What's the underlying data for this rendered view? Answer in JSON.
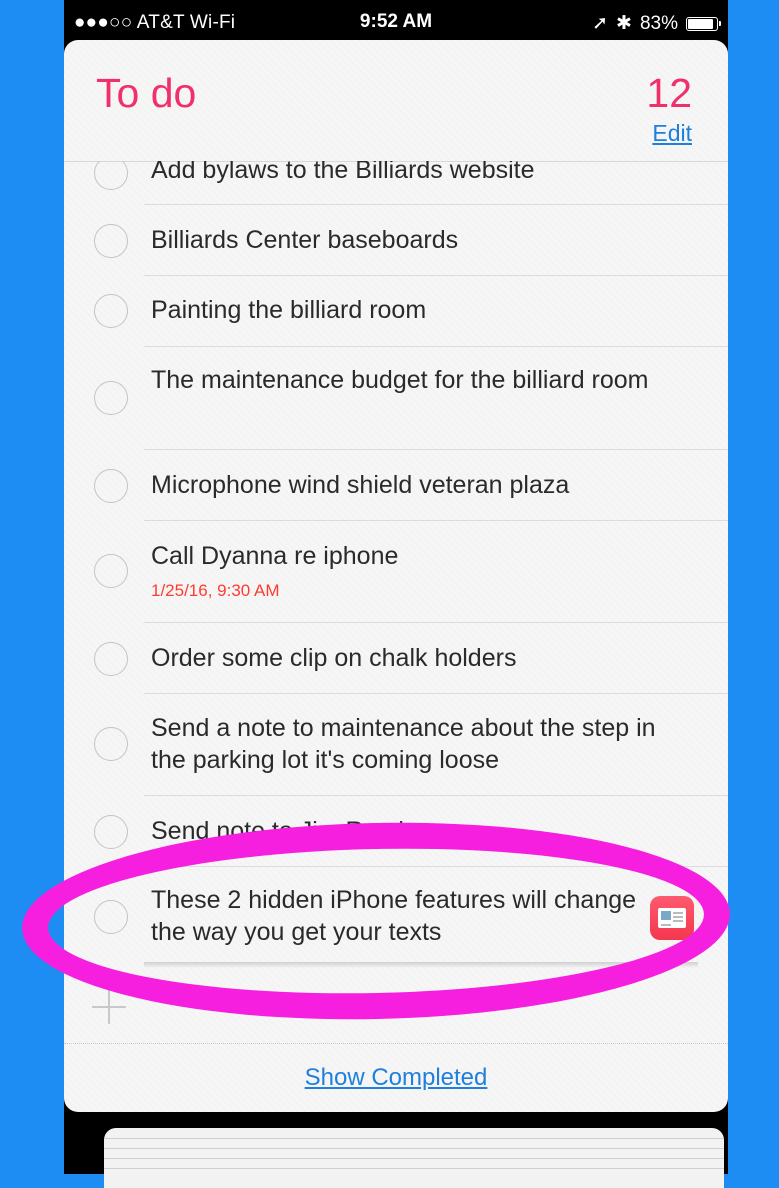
{
  "status_bar": {
    "carrier": "●●●○○ AT&T Wi-Fi",
    "time": "9:52 AM",
    "battery": "83%"
  },
  "list": {
    "title": "To do",
    "count": "12",
    "edit_label": "Edit",
    "items": [
      {
        "text": "Add bylaws to the Billiards website"
      },
      {
        "text": "Billiards Center baseboards"
      },
      {
        "text": "Painting the billiard room"
      },
      {
        "text": "The maintenance budget for the billiard room"
      },
      {
        "text": "Microphone wind shield veteran plaza"
      },
      {
        "text": "Call Dyanna re iphone",
        "due": "1/25/16, 9:30 AM"
      },
      {
        "text": "Order some clip on chalk holders"
      },
      {
        "text": "Send a note to maintenance about the step in the parking lot it's coming loose"
      },
      {
        "text": "Send note to Jim Romine"
      },
      {
        "text": "These 2 hidden iPhone features will change the way you get your texts",
        "attachment": "news-app-icon"
      }
    ],
    "show_completed_label": "Show Completed"
  },
  "colors": {
    "background": "#1e8df3",
    "title": "#f0306a",
    "link": "#1e7fdc",
    "due": "#ff3b30",
    "highlight": "#f61fe0"
  }
}
